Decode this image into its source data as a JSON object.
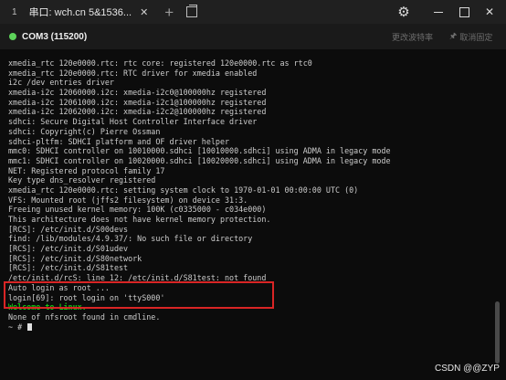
{
  "titlebar": {
    "tab_number": "1",
    "tab_title": "串口: wch.cn 5&1536...",
    "close_glyph": "✕",
    "new_tab_glyph": "+",
    "settings_glyph": "⚙",
    "close_window_glyph": "✕"
  },
  "toolbar": {
    "connection_label": "COM3 (115200)",
    "status_color": "#5dd35a",
    "change_baud_label": "更改波特率",
    "unpin_label": "取消固定",
    "pin_glyph": "🖈"
  },
  "terminal": {
    "lines": [
      "xmedia_rtc 120e0000.rtc: rtc core: registered 120e0000.rtc as rtc0",
      "xmedia_rtc 120e0000.rtc: RTC driver for xmedia enabled",
      "i2c /dev entries driver",
      "xmedia-i2c 12060000.i2c: xmedia-i2c0@100000hz registered",
      "xmedia-i2c 12061000.i2c: xmedia-i2c1@100000hz registered",
      "xmedia-i2c 12062000.i2c: xmedia-i2c2@100000hz registered",
      "sdhci: Secure Digital Host Controller Interface driver",
      "sdhci: Copyright(c) Pierre Ossman",
      "sdhci-pltfm: SDHCI platform and OF driver helper",
      "mmc0: SDHCI controller on 10010000.sdhci [10010000.sdhci] using ADMA in legacy mode",
      "mmc1: SDHCI controller on 10020000.sdhci [10020000.sdhci] using ADMA in legacy mode",
      "NET: Registered protocol family 17",
      "Key type dns_resolver registered",
      "xmedia_rtc 120e0000.rtc: setting system clock to 1970-01-01 00:00:00 UTC (0)",
      "VFS: Mounted root (jffs2 filesystem) on device 31:3.",
      "Freeing unused kernel memory: 100K (c0335000 - c034e000)",
      "This architecture does not have kernel memory protection.",
      "[RCS]: /etc/init.d/S00devs",
      "find: /lib/modules/4.9.37/: No such file or directory",
      "[RCS]: /etc/init.d/S01udev",
      "[RCS]: /etc/init.d/S80network",
      "[RCS]: /etc/init.d/S81test",
      "/etc/init.d/rcS: line 12: /etc/init.d/S81test: not found",
      "Auto login as root ...",
      "login[69]: root login on 'ttyS000'",
      "Welcome to Linux.",
      "None of nfsroot found in cmdline.",
      "~ #"
    ],
    "green_line_index": 25,
    "text_color": "#cccccc",
    "highlight_color": "#d92525"
  },
  "watermark": "CSDN @@ZYP"
}
